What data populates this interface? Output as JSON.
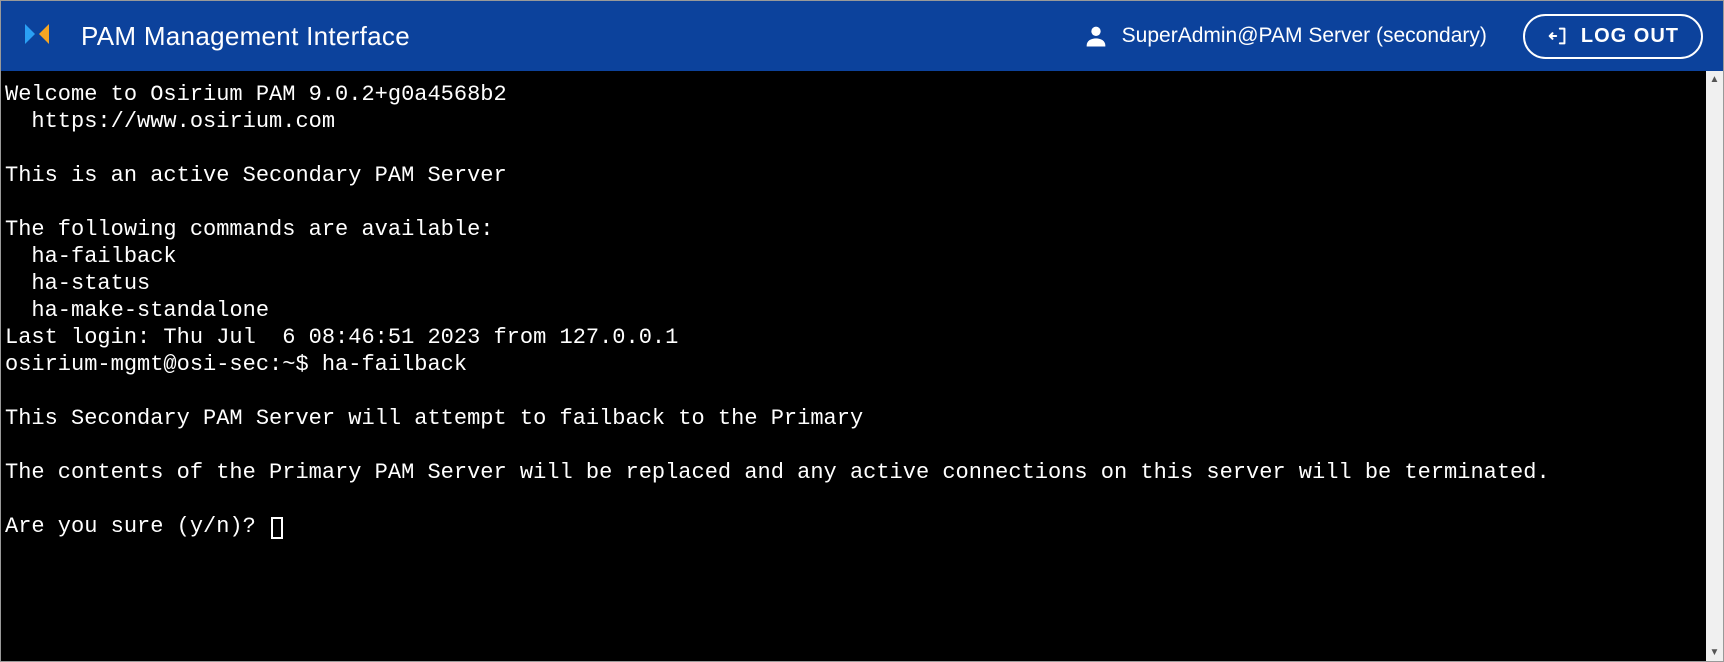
{
  "header": {
    "title": "PAM Management Interface",
    "user_label": "SuperAdmin@PAM Server (secondary)",
    "logout_label": "LOG OUT"
  },
  "terminal": {
    "lines": [
      "Welcome to Osirium PAM 9.0.2+g0a4568b2",
      "  https://www.osirium.com",
      "",
      "This is an active Secondary PAM Server",
      "",
      "The following commands are available:",
      "  ha-failback",
      "  ha-status",
      "  ha-make-standalone",
      "Last login: Thu Jul  6 08:46:51 2023 from 127.0.0.1",
      "osirium-mgmt@osi-sec:~$ ha-failback",
      "",
      "This Secondary PAM Server will attempt to failback to the Primary",
      "",
      "The contents of the Primary PAM Server will be replaced and any active connections on this server will be terminated.",
      "",
      "Are you sure (y/n)? "
    ]
  }
}
